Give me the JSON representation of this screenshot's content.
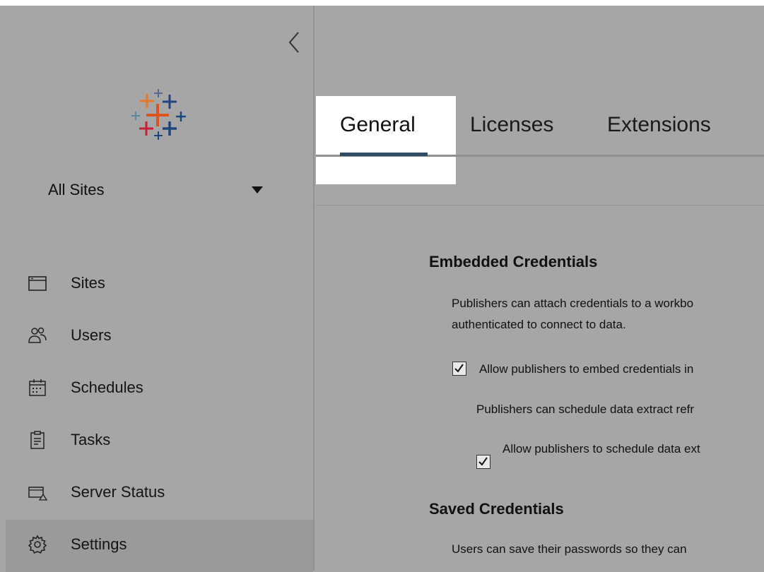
{
  "sidebar": {
    "site_selector": {
      "label": "All Sites"
    },
    "items": [
      {
        "label": "Sites",
        "icon": "sites-icon"
      },
      {
        "label": "Users",
        "icon": "users-icon"
      },
      {
        "label": "Schedules",
        "icon": "calendar-icon"
      },
      {
        "label": "Tasks",
        "icon": "clipboard-icon"
      },
      {
        "label": "Server Status",
        "icon": "server-status-icon"
      },
      {
        "label": "Settings",
        "icon": "gear-icon",
        "active": true
      }
    ]
  },
  "tabs": [
    {
      "label": "General",
      "active": true
    },
    {
      "label": "Licenses"
    },
    {
      "label": "Extensions"
    }
  ],
  "sections": {
    "embedded": {
      "heading": "Embedded Credentials",
      "description_line1": "Publishers can attach credentials to a workbo",
      "description_line2": "authenticated to connect to data.",
      "checkbox1_label": "Allow publishers to embed credentials in",
      "checkbox1_checked": true,
      "sub_description": "Publishers can schedule data extract refr",
      "checkbox2_label": "Allow publishers to schedule data ext",
      "checkbox2_checked": true
    },
    "saved": {
      "heading": "Saved Credentials",
      "description": "Users can save their passwords so they can"
    }
  },
  "colors": {
    "background": "#a6a6a6",
    "tab_underline": "#2e4d63",
    "highlight": "#ffffff"
  }
}
